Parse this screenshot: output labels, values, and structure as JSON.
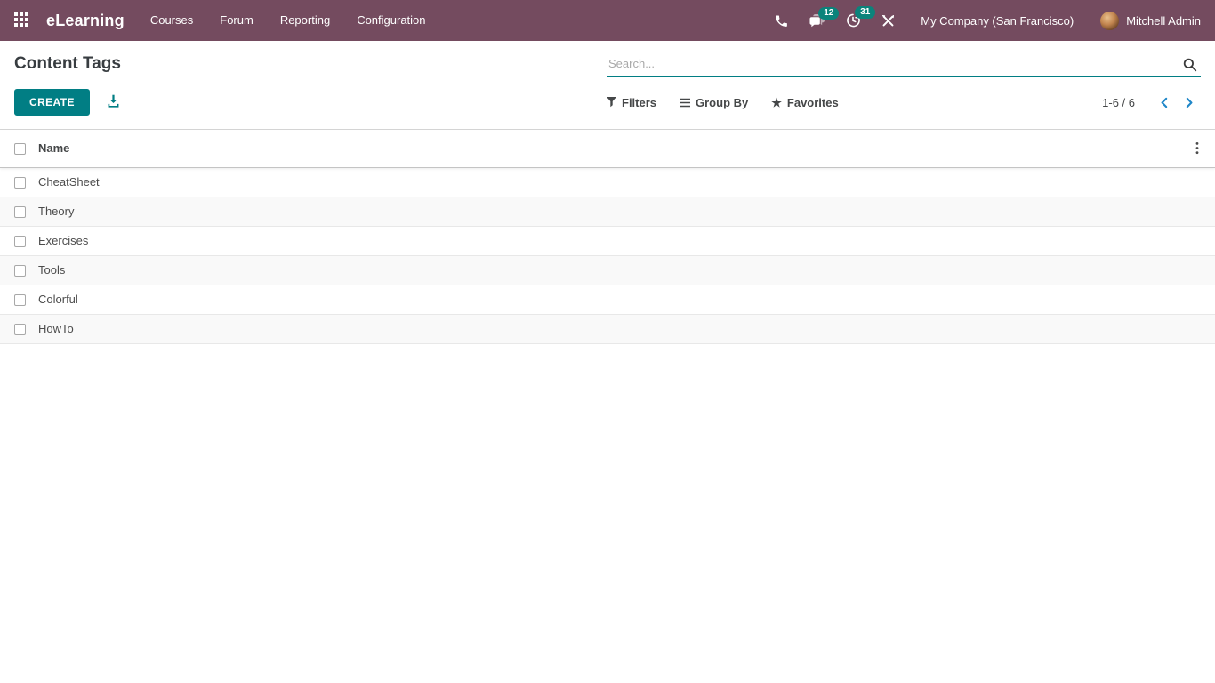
{
  "topbar": {
    "app_name": "eLearning",
    "menu_items": [
      "Courses",
      "Forum",
      "Reporting",
      "Configuration"
    ],
    "messages_count": "12",
    "activities_count": "31",
    "company_name": "My Company (San Francisco)",
    "user_name": "Mitchell Admin"
  },
  "control_panel": {
    "title": "Content Tags",
    "create_button": "CREATE",
    "search": {
      "placeholder": "Search..."
    },
    "filters_label": "Filters",
    "group_by_label": "Group By",
    "favorites_label": "Favorites",
    "pager": {
      "text": "1-6 / 6"
    }
  },
  "table": {
    "columns": [
      "Name"
    ],
    "rows": [
      "CheatSheet",
      "Theory",
      "Exercises",
      "Tools",
      "Colorful",
      "HowTo"
    ]
  },
  "colors": {
    "topbar_bg": "#744B5F",
    "primary_teal": "#017E84",
    "badge_teal": "#0B837B",
    "pager_arrows": "#2087C8",
    "row_stripe": "#F9F9F9"
  }
}
